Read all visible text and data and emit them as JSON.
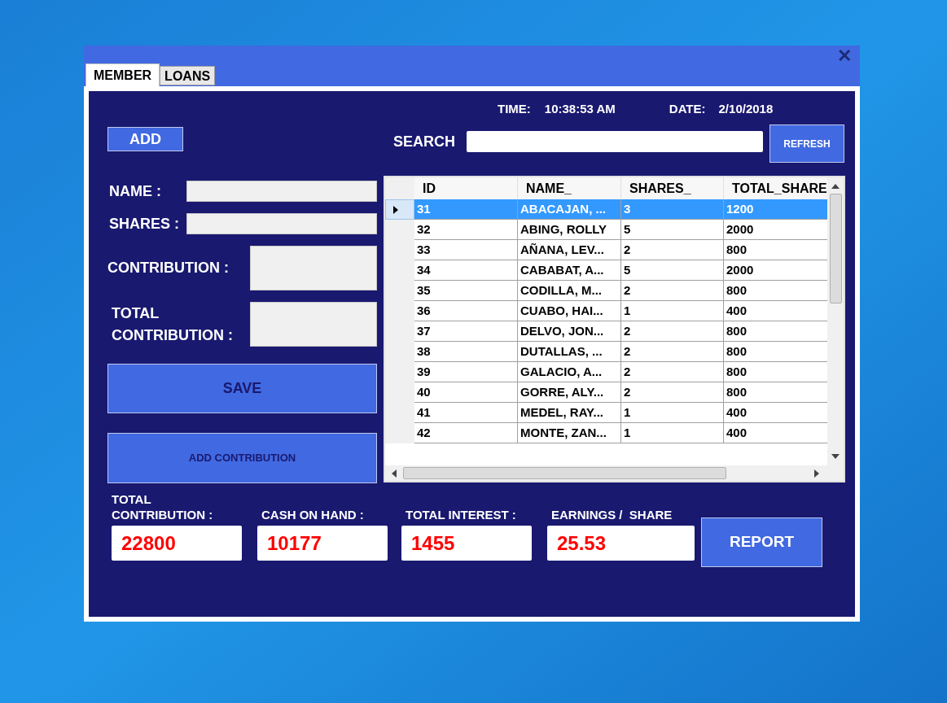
{
  "window": {
    "close": "✕"
  },
  "tabs": [
    {
      "label": "MEMBER",
      "selected": true
    },
    {
      "label": "LOANS",
      "selected": false
    }
  ],
  "clock": {
    "time_label": "TIME:",
    "time": "10:38:53 AM",
    "date_label": "DATE:",
    "date": "2/10/2018"
  },
  "add_button": "ADD",
  "search": {
    "label": "SEARCH"
  },
  "refresh_button": "REFRESH",
  "form": {
    "fields": [
      {
        "label": "NAME :",
        "kind": "short"
      },
      {
        "label": "SHARES :",
        "kind": "short"
      },
      {
        "label": "CONTRIBUTION :",
        "kind": "tall"
      },
      {
        "label": "TOTAL CONTRIBUTION :",
        "kind": "tall"
      }
    ],
    "save_button": "SAVE",
    "add_contribution_button": "ADD CONTRIBUTION"
  },
  "table": {
    "columns": [
      "ID",
      "NAME_",
      "SHARES_",
      "TOTAL_SHARE"
    ],
    "rows": [
      {
        "cells": [
          "31",
          "ABACAJAN, ...",
          "3",
          "1200"
        ],
        "selected": true
      },
      {
        "cells": [
          "32",
          "ABING, ROLLY",
          "5",
          "2000"
        ],
        "selected": false
      },
      {
        "cells": [
          "33",
          "AÑANA, LEV...",
          "2",
          "800"
        ],
        "selected": false
      },
      {
        "cells": [
          "34",
          "CABABAT, A...",
          "5",
          "2000"
        ],
        "selected": false
      },
      {
        "cells": [
          "35",
          "CODILLA, M...",
          "2",
          "800"
        ],
        "selected": false
      },
      {
        "cells": [
          "36",
          "CUABO, HAI...",
          "1",
          "400"
        ],
        "selected": false
      },
      {
        "cells": [
          "37",
          "DELVO, JON...",
          "2",
          "800"
        ],
        "selected": false
      },
      {
        "cells": [
          "38",
          "DUTALLAS, ...",
          "2",
          "800"
        ],
        "selected": false
      },
      {
        "cells": [
          "39",
          "GALACIO, A...",
          "2",
          "800"
        ],
        "selected": false
      },
      {
        "cells": [
          "40",
          "GORRE, ALY...",
          "2",
          "800"
        ],
        "selected": false
      },
      {
        "cells": [
          "41",
          "MEDEL, RAY...",
          "1",
          "400"
        ],
        "selected": false
      },
      {
        "cells": [
          "42",
          "MONTE, ZAN...",
          "1",
          "400"
        ],
        "selected": false
      }
    ]
  },
  "totals": [
    {
      "label": "TOTAL CONTRIBUTION :",
      "value": "22800"
    },
    {
      "label": "CASH ON HAND :",
      "value": "10177"
    },
    {
      "label": "TOTAL INTEREST :",
      "value": "1455"
    },
    {
      "label": "EARNINGS /  SHARE",
      "value": "25.53"
    }
  ],
  "report_button": "REPORT"
}
